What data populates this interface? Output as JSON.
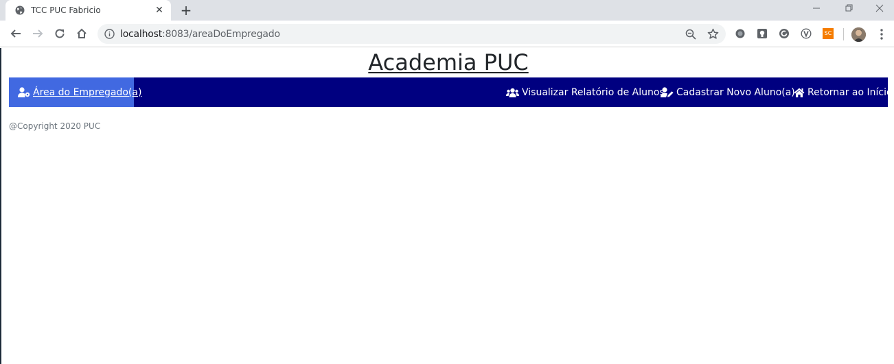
{
  "browser": {
    "tab_title": "TCC PUC Fabricio",
    "tab_close": "✕",
    "new_tab": "+",
    "url_host": "localhost",
    "url_path": ":8083/areaDoEmpregado",
    "extensions": {
      "sc_label": "SC"
    }
  },
  "page": {
    "title": "Academia PUC",
    "nav": {
      "active_label": "Área do Empregado(a)",
      "items": [
        {
          "label": "Visualizar Relatório de Alunos",
          "icon": "users-icon"
        },
        {
          "label": "Cadastrar Novo Aluno(a)",
          "icon": "user-edit-icon"
        },
        {
          "label": "Retornar ao Início",
          "icon": "home-icon"
        }
      ]
    },
    "footer": "@Copyright 2020 PUC"
  },
  "colors": {
    "navbar": "#000080",
    "nav_active": "#4169e1"
  }
}
